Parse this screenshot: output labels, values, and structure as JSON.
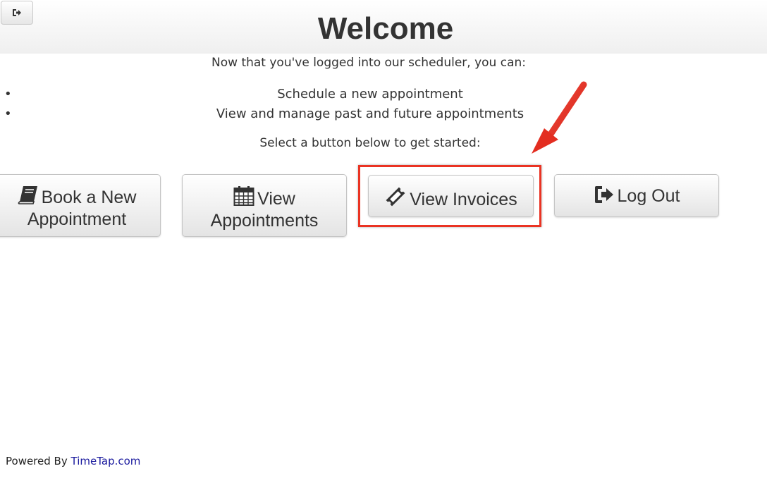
{
  "header": {
    "title": "Welcome",
    "corner_button_icon": "sign-out-icon"
  },
  "intro": {
    "text": "Now that you've logged into our scheduler, you can:",
    "bullets": [
      "Schedule a new appointment",
      "View and manage past and future appointments"
    ],
    "prompt": "Select a button below to get started:"
  },
  "buttons": {
    "book": {
      "line1": "Book a New",
      "line2": "Appointment",
      "icon": "book-icon"
    },
    "appointments": {
      "line1": "View",
      "line2": "Appointments",
      "icon": "calendar-icon"
    },
    "invoices": {
      "label": "View Invoices",
      "icon": "ticket-icon"
    },
    "logout": {
      "label": "Log Out",
      "icon": "sign-out-icon"
    }
  },
  "annotation": {
    "highlight_color": "#ea3323",
    "target": "invoices"
  },
  "footer": {
    "prefix": "Powered By",
    "link": "TimeTap.com"
  }
}
